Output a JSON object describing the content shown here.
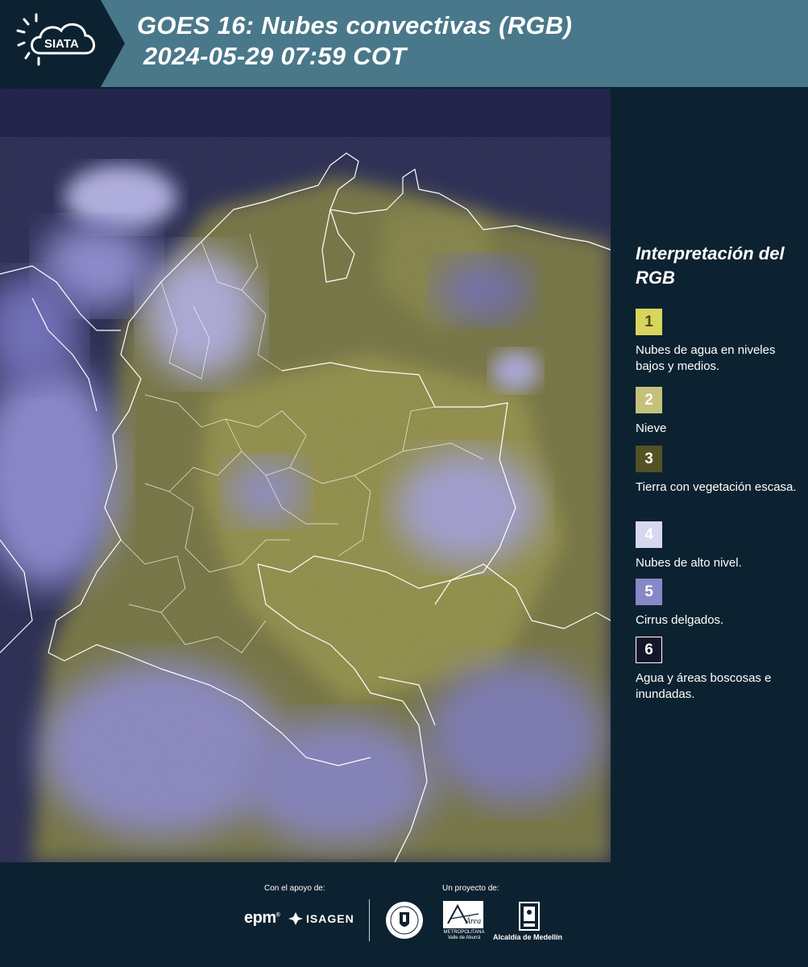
{
  "header": {
    "logo_text": "SIATA",
    "title_line1": "GOES 16: Nubes convectivas (RGB)",
    "title_line2": "2024-05-29 07:59 COT"
  },
  "legend": {
    "title": "Interpretación del RGB",
    "items": [
      {
        "number": "1",
        "label": "Nubes de agua en niveles bajos y medios.",
        "color": "#d7d55d",
        "text_color": "#4a4a1a"
      },
      {
        "number": "2",
        "label": "Nieve",
        "color": "#c4c17a",
        "text_color": "#ffffff"
      },
      {
        "number": "3",
        "label": "Tierra con vegetación escasa.",
        "color": "#545124",
        "text_color": "#ffffff"
      },
      {
        "number": "4",
        "label": "Nubes de alto nivel.",
        "color": "#d8d7f0",
        "text_color": "#ffffff"
      },
      {
        "number": "5",
        "label": "Cirrus delgados.",
        "color": "#8887c8",
        "text_color": "#ffffff"
      },
      {
        "number": "6",
        "label": "Agua y áreas boscosas e inundadas.",
        "color": "#14152a",
        "text_color": "#ffffff"
      }
    ]
  },
  "footer": {
    "support_label": "Con el apoyo de:",
    "project_label": "Un proyecto de:",
    "epm": "epm",
    "isagen": "ISAGEN",
    "area_text": "METROPOLITANA Valle de Aburrá",
    "area_brand": "Área",
    "alcaldia": "Alcaldía de Medellín"
  },
  "colors": {
    "header_bg": "#49788a",
    "panel_bg": "#0d2230",
    "map_water": "#1d1f4a",
    "map_land": "#7b7a4a",
    "clouds": "#a9a7e6"
  }
}
